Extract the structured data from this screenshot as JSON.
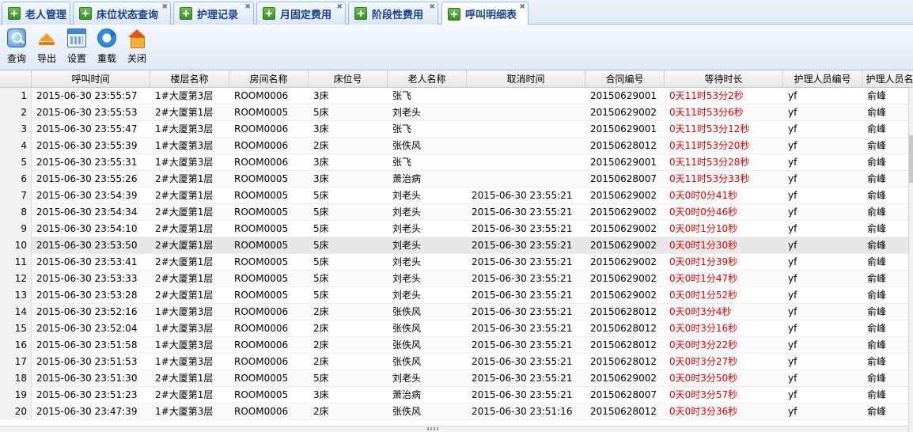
{
  "tabs": [
    {
      "label": "老人管理",
      "active": false,
      "closable": false
    },
    {
      "label": "床位状态查询",
      "active": false,
      "closable": true
    },
    {
      "label": "护理记录",
      "active": false,
      "closable": true
    },
    {
      "label": "月固定费用",
      "active": false,
      "closable": true
    },
    {
      "label": "阶段性费用",
      "active": false,
      "closable": true
    },
    {
      "label": "呼叫明细表",
      "active": true,
      "closable": true
    }
  ],
  "toolbar": {
    "search_label": "查询",
    "export_label": "导出",
    "settings_label": "设置",
    "reload_label": "重载",
    "close_label": "关闭"
  },
  "grid": {
    "columns": [
      "呼叫时间",
      "楼层名称",
      "房间名称",
      "床位号",
      "老人名称",
      "取消时间",
      "合同编号",
      "等待时长",
      "护理人员编号",
      "护理人员名"
    ],
    "rows": [
      [
        "1",
        "2015-06-30 23:55:57",
        "1#大厦第3层",
        "ROOM0006",
        "3床",
        "张飞",
        "",
        "20150629001",
        "0天11时53分2秒",
        "yf",
        "俞峰"
      ],
      [
        "2",
        "2015-06-30 23:55:53",
        "2#大厦第1层",
        "ROOM0005",
        "5床",
        "刘老头",
        "",
        "20150629002",
        "0天11时53分6秒",
        "yf",
        "俞峰"
      ],
      [
        "3",
        "2015-06-30 23:55:47",
        "1#大厦第3层",
        "ROOM0006",
        "3床",
        "张飞",
        "",
        "20150629001",
        "0天11时53分12秒",
        "yf",
        "俞峰"
      ],
      [
        "4",
        "2015-06-30 23:55:39",
        "1#大厦第3层",
        "ROOM0006",
        "2床",
        "张佚风",
        "",
        "20150628012",
        "0天11时53分20秒",
        "yf",
        "俞峰"
      ],
      [
        "5",
        "2015-06-30 23:55:31",
        "1#大厦第3层",
        "ROOM0006",
        "3床",
        "张飞",
        "",
        "20150629001",
        "0天11时53分28秒",
        "yf",
        "俞峰"
      ],
      [
        "6",
        "2015-06-30 23:55:26",
        "2#大厦第1层",
        "ROOM0005",
        "3床",
        "萧治病",
        "",
        "20150628007",
        "0天11时53分33秒",
        "yf",
        "俞峰"
      ],
      [
        "7",
        "2015-06-30 23:54:39",
        "2#大厦第1层",
        "ROOM0005",
        "5床",
        "刘老头",
        "2015-06-30 23:55:21",
        "20150629002",
        "0天0时0分41秒",
        "yf",
        "俞峰"
      ],
      [
        "8",
        "2015-06-30 23:54:34",
        "2#大厦第1层",
        "ROOM0005",
        "5床",
        "刘老头",
        "2015-06-30 23:55:21",
        "20150629002",
        "0天0时0分46秒",
        "yf",
        "俞峰"
      ],
      [
        "9",
        "2015-06-30 23:54:10",
        "2#大厦第1层",
        "ROOM0005",
        "5床",
        "刘老头",
        "2015-06-30 23:55:21",
        "20150629002",
        "0天0时1分10秒",
        "yf",
        "俞峰"
      ],
      [
        "10",
        "2015-06-30 23:53:50",
        "2#大厦第1层",
        "ROOM0005",
        "5床",
        "刘老头",
        "2015-06-30 23:55:21",
        "20150629002",
        "0天0时1分30秒",
        "yf",
        "俞峰"
      ],
      [
        "11",
        "2015-06-30 23:53:41",
        "2#大厦第1层",
        "ROOM0005",
        "5床",
        "刘老头",
        "2015-06-30 23:55:21",
        "20150629002",
        "0天0时1分39秒",
        "yf",
        "俞峰"
      ],
      [
        "12",
        "2015-06-30 23:53:33",
        "2#大厦第1层",
        "ROOM0005",
        "5床",
        "刘老头",
        "2015-06-30 23:55:21",
        "20150629002",
        "0天0时1分47秒",
        "yf",
        "俞峰"
      ],
      [
        "13",
        "2015-06-30 23:53:28",
        "2#大厦第1层",
        "ROOM0005",
        "5床",
        "刘老头",
        "2015-06-30 23:55:21",
        "20150629002",
        "0天0时1分52秒",
        "yf",
        "俞峰"
      ],
      [
        "14",
        "2015-06-30 23:52:16",
        "1#大厦第3层",
        "ROOM0006",
        "2床",
        "张佚风",
        "2015-06-30 23:55:21",
        "20150628012",
        "0天0时3分4秒",
        "yf",
        "俞峰"
      ],
      [
        "15",
        "2015-06-30 23:52:04",
        "1#大厦第3层",
        "ROOM0006",
        "2床",
        "张佚风",
        "2015-06-30 23:55:21",
        "20150628012",
        "0天0时3分16秒",
        "yf",
        "俞峰"
      ],
      [
        "16",
        "2015-06-30 23:51:58",
        "1#大厦第3层",
        "ROOM0006",
        "2床",
        "张佚风",
        "2015-06-30 23:55:21",
        "20150628012",
        "0天0时3分22秒",
        "yf",
        "俞峰"
      ],
      [
        "17",
        "2015-06-30 23:51:53",
        "1#大厦第3层",
        "ROOM0006",
        "2床",
        "张佚风",
        "2015-06-30 23:55:21",
        "20150628012",
        "0天0时3分27秒",
        "yf",
        "俞峰"
      ],
      [
        "18",
        "2015-06-30 23:51:30",
        "2#大厦第1层",
        "ROOM0005",
        "5床",
        "刘老头",
        "2015-06-30 23:55:21",
        "20150629002",
        "0天0时3分50秒",
        "yf",
        "俞峰"
      ],
      [
        "19",
        "2015-06-30 23:51:23",
        "2#大厦第1层",
        "ROOM0005",
        "3床",
        "萧治病",
        "2015-06-30 23:55:21",
        "20150628007",
        "0天0时3分57秒",
        "yf",
        "俞峰"
      ],
      [
        "20",
        "2015-06-30 23:47:39",
        "1#大厦第3层",
        "ROOM0006",
        "2床",
        "张佚风",
        "2015-06-30 23:51:16",
        "20150628012",
        "0天0时3分36秒",
        "yf",
        "俞峰"
      ]
    ]
  },
  "colors": {
    "wait_text": "#e00000",
    "tab_text": "#15428b",
    "border": "#99bbe8"
  },
  "icons": {
    "search": "magnifier-icon",
    "export": "export-icon",
    "settings": "calendar-icon",
    "reload": "reload-icon",
    "close": "home-icon"
  }
}
